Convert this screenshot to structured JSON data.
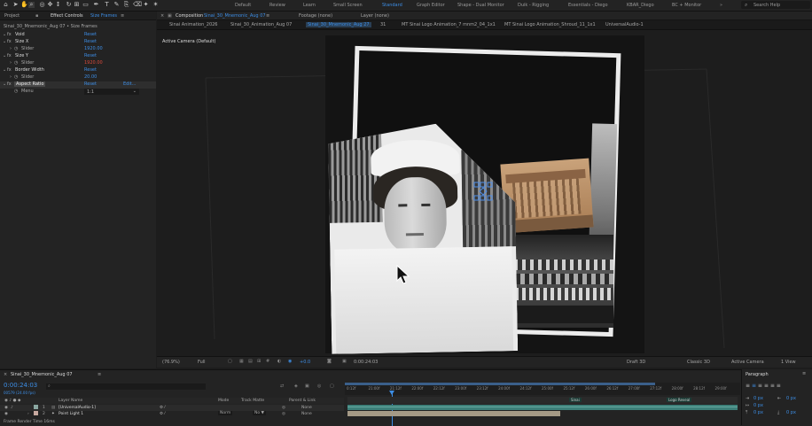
{
  "workspaces": [
    "Default",
    "Review",
    "Learn",
    "Small Screen",
    "Standard",
    "Graph Editor",
    "Shape - Dual Monitor",
    "Duik - Rigging",
    "Essentials - Diego",
    "KBAR_Diego",
    "BC + Monitor"
  ],
  "active_workspace": "Standard",
  "search_help": "Search Help",
  "effect_panel": {
    "project_tab": "Project",
    "effect_controls_label": "Effect Controls",
    "effect_controls_layer": "Size Frames",
    "comp_layer_path": "Sinai_30_Mnemonic_Aug 07 • Size Frames",
    "rows": [
      {
        "name": "Void",
        "value": "Reset",
        "indent": 0,
        "type": "fx"
      },
      {
        "name": "Size X",
        "value": "Reset",
        "indent": 0,
        "type": "fx"
      },
      {
        "name": "Slider",
        "value": "1920.00",
        "indent": 1,
        "type": "param"
      },
      {
        "name": "Size Y",
        "value": "Reset",
        "indent": 0,
        "type": "fx"
      },
      {
        "name": "Slider",
        "value": "1920.00",
        "indent": 1,
        "type": "param-red"
      },
      {
        "name": "Border Width",
        "value": "Reset",
        "indent": 0,
        "type": "fx"
      },
      {
        "name": "Slider",
        "value": "20.00",
        "indent": 1,
        "type": "param"
      },
      {
        "name": "Aspect Ratio",
        "value": "Reset",
        "extra": "Edit...",
        "indent": 0,
        "type": "fx-selected"
      },
      {
        "name": "Menu",
        "value": "1:1",
        "indent": 1,
        "type": "menu"
      }
    ]
  },
  "comp_panel": {
    "composition_label": "Composition",
    "composition_name": "Sinai_30_Mnemonic_Aug 07",
    "footage_label": "Footage (none)",
    "layer_label": "Layer (none)",
    "comp_tabs": [
      "Sinai Animation_2026",
      "Sinai_30_Animation_Aug 07",
      "Sinai_30_Mnemonic_Aug 27",
      "31",
      "MT Sinai Logo Animation_7 mnm2_04_1x1",
      "MT Sinai Logo Animation_Shroud_11_1x1",
      "UniversalAudio-1"
    ],
    "active_camera": "Active Camera (Default)",
    "zoom": "(76.9%)",
    "resolution": "Full",
    "timecode": "0:00:24:03",
    "exposure": "+0.0",
    "renderer_label": "Draft 3D",
    "renderer": "Classic 3D",
    "view": "Active Camera",
    "view_count": "1 View"
  },
  "timeline": {
    "comp_name": "Sinai_30_Mnemonic_Aug 07",
    "timecode": "0:00:24:03",
    "fps_info": "00579 (24.00 fps)",
    "search_placeholder": "",
    "columns": {
      "layer_name": "Layer Name",
      "mode": "Mode",
      "trkmat": "TrkMat",
      "track_matte": "Track Matte",
      "parent": "Parent & Link"
    },
    "layers": [
      {
        "index": "1",
        "name": "[UniversalAudio-1]",
        "mode": "",
        "trkmat": "",
        "parent": "None"
      },
      {
        "index": "2",
        "name": "Point Light 1",
        "mode": "Norm",
        "trkmat": "No ▼",
        "parent": "None"
      }
    ],
    "ruler": [
      "0:12f",
      "21:00f",
      "21:12f",
      "22:00f",
      "22:12f",
      "23:00f",
      "23:12f",
      "24:00f",
      "24:12f",
      "25:00f",
      "25:12f",
      "26:00f",
      "26:12f",
      "27:00f",
      "27:12f",
      "28:00f",
      "28:12f",
      "29:00f"
    ],
    "bar_label_1": "Sinai",
    "bar_label_2": "Logo Reveal",
    "render_time": "Frame Render Time 16ms"
  },
  "paragraph_panel": {
    "title": "Paragraph",
    "values": [
      "0 px",
      "0 px",
      "0 px",
      "0 px",
      "0 px"
    ]
  },
  "colors": {
    "accent": "#3d8ee6",
    "panel_bg": "#232323",
    "viewer_bg": "#1d1d1d",
    "teal_bar": "#3d7f79",
    "tan_bar": "#a59a86"
  }
}
